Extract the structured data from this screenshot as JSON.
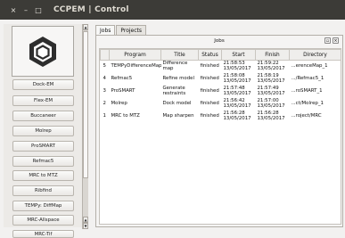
{
  "window": {
    "title": "CCPEM | Control",
    "controls": [
      "×",
      "–",
      "□"
    ]
  },
  "sidebar": {
    "logo_icon": "ccpem-hexagon-logo",
    "buttons": [
      {
        "label": "Dock-EM"
      },
      {
        "label": "Flex-EM"
      },
      {
        "label": "Buccaneer"
      },
      {
        "label": "Molrep"
      },
      {
        "label": "ProSMART"
      },
      {
        "label": "Refmac5"
      },
      {
        "label": "MRC to MTZ"
      },
      {
        "label": "Ribfind"
      },
      {
        "label": "TEMPy: DiffMap"
      },
      {
        "label": "MRC-Allspace"
      },
      {
        "label": "MRC-Tif"
      }
    ],
    "scroll_up": "▲",
    "scroll_down": "▼"
  },
  "tabs": [
    {
      "label": "Jobs",
      "active": true
    },
    {
      "label": "Projects",
      "active": false
    }
  ],
  "jobs_pane": {
    "title": "Jobs",
    "icons": [
      "restore-icon",
      "close-icon"
    ],
    "columns": [
      "",
      "Program",
      "Title",
      "Status",
      "Start",
      "Finish",
      "Directory"
    ],
    "rows": [
      {
        "id": "5",
        "program": "TEMPyDifferenceMap",
        "title": "Difference map",
        "status": "finished",
        "start": "21:58:53 13/05/2017",
        "finish": "21:59:22 13/05/2017",
        "directory": "...erenceMap_1"
      },
      {
        "id": "4",
        "program": "Refmac5",
        "title": "Refine model",
        "status": "finished",
        "start": "21:58:08 13/05/2017",
        "finish": "21:58:19 13/05/2017",
        "directory": ".../Refmac5_1"
      },
      {
        "id": "3",
        "program": "ProSMART",
        "title": "Generate restraints",
        "status": "finished",
        "start": "21:57:48 13/05/2017",
        "finish": "21:57:49 13/05/2017",
        "directory": "...roSMART_1"
      },
      {
        "id": "2",
        "program": "Molrep",
        "title": "Dock model",
        "status": "finished",
        "start": "21:56:42 13/05/2017",
        "finish": "21:57:00 13/05/2017",
        "directory": "...ct/Molrep_1"
      },
      {
        "id": "1",
        "program": "MRC to MTZ",
        "title": "Map sharpen",
        "status": "finished",
        "start": "21:56:28 13/05/2017",
        "finish": "21:56:28 13/05/2017",
        "directory": "...roject/MRC"
      }
    ]
  }
}
